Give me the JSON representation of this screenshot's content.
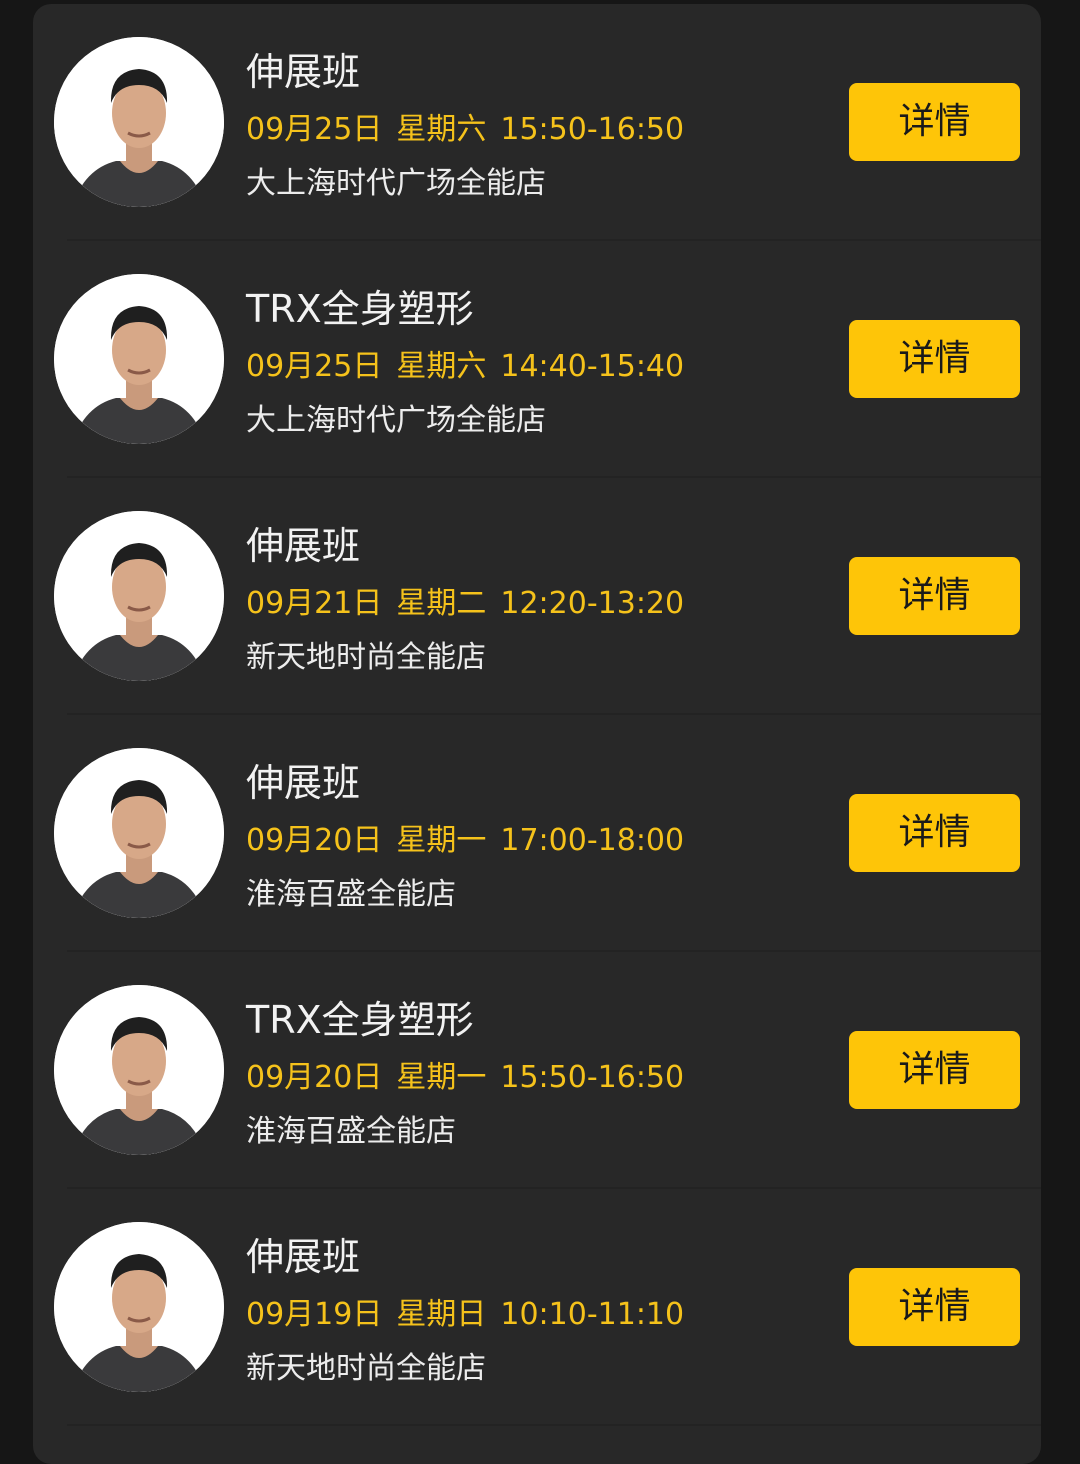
{
  "colors": {
    "page_background": "#161616",
    "panel_background": "#282828",
    "title_text": "#f2f2f2",
    "schedule_text": "#f5c21b",
    "location_text": "#ececec",
    "button_background": "#fec508",
    "button_text": "#1a1a1a"
  },
  "classes": [
    {
      "avatar_icon": "trainer-avatar",
      "title": "伸展班",
      "date": "09月25日",
      "weekday": "星期六",
      "time": "15:50-16:50",
      "location": "大上海时代广场全能店",
      "button_label": "详情"
    },
    {
      "avatar_icon": "trainer-avatar",
      "title": "TRX全身塑形",
      "date": "09月25日",
      "weekday": "星期六",
      "time": "14:40-15:40",
      "location": "大上海时代广场全能店",
      "button_label": "详情"
    },
    {
      "avatar_icon": "trainer-avatar",
      "title": "伸展班",
      "date": "09月21日",
      "weekday": "星期二",
      "time": "12:20-13:20",
      "location": "新天地时尚全能店",
      "button_label": "详情"
    },
    {
      "avatar_icon": "trainer-avatar",
      "title": "伸展班",
      "date": "09月20日",
      "weekday": "星期一",
      "time": "17:00-18:00",
      "location": "淮海百盛全能店",
      "button_label": "详情"
    },
    {
      "avatar_icon": "trainer-avatar",
      "title": "TRX全身塑形",
      "date": "09月20日",
      "weekday": "星期一",
      "time": "15:50-16:50",
      "location": "淮海百盛全能店",
      "button_label": "详情"
    },
    {
      "avatar_icon": "trainer-avatar",
      "title": "伸展班",
      "date": "09月19日",
      "weekday": "星期日",
      "time": "10:10-11:10",
      "location": "新天地时尚全能店",
      "button_label": "详情"
    }
  ]
}
